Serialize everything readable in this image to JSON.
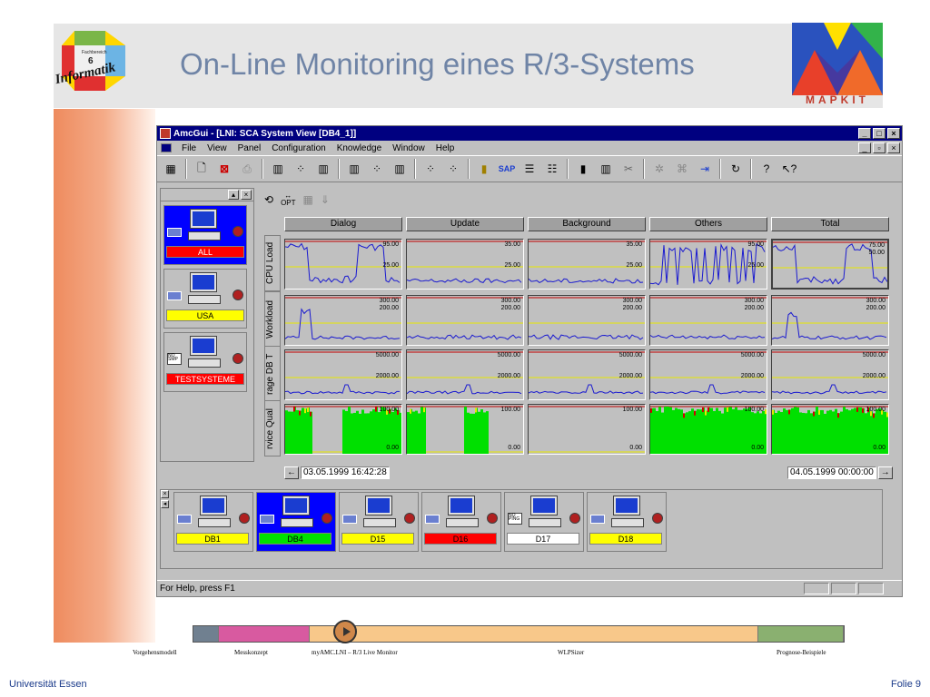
{
  "slide": {
    "title": "On-Line Monitoring eines R/3-Systems",
    "logo_left_text": [
      "Fachbereich",
      "6",
      "Informatik"
    ],
    "logo_right_text": "MAPKIT",
    "footer_left": "Universität Essen",
    "footer_right": "Folie 9"
  },
  "window": {
    "title": "AmcGui - [LNI: SCA System View [DB4_1]]",
    "menu": [
      "File",
      "View",
      "Panel",
      "Configuration",
      "Knowledge",
      "Window",
      "Help"
    ],
    "status": "For Help, press F1",
    "mini_toolbar_opt": "OPT"
  },
  "left_systems": [
    {
      "label": "ALL",
      "color": "#ff0000",
      "text_color": "#ffffff",
      "selected": true,
      "left_badge": ""
    },
    {
      "label": "USA",
      "color": "#ffff00",
      "text_color": "#000000",
      "selected": false,
      "left_badge": ""
    },
    {
      "label": "TESTSYSTEME",
      "color": "#ff0000",
      "text_color": "#ffffff",
      "selected": false,
      "left_badge": "NO SMP"
    }
  ],
  "columns": [
    "Dialog",
    "Update",
    "Background",
    "Others",
    "Total"
  ],
  "rows": [
    "CPU Load",
    "Workload",
    "rage DB T",
    "rvice Qual"
  ],
  "cell_labels": {
    "cpu": [
      [
        "95.00",
        "25.00"
      ],
      [
        "35.00",
        "25.00"
      ],
      [
        "35.00",
        "25.00"
      ],
      [
        "95.00",
        "25.00"
      ],
      [
        "75.00",
        "50.00"
      ]
    ],
    "workload": [
      [
        "300.00",
        "200.00"
      ],
      [
        "300.00",
        "200.00"
      ],
      [
        "300.00",
        "200.00"
      ],
      [
        "300.00",
        "200.00"
      ],
      [
        "300.00",
        "200.00"
      ]
    ],
    "db": [
      [
        "5000.00",
        "2000.00"
      ],
      [
        "5000.00",
        "2000.00"
      ],
      [
        "5000.00",
        "2000.00"
      ],
      [
        "5000.00",
        "2000.00"
      ],
      [
        "5000.00",
        "2000.00"
      ]
    ],
    "qual": [
      [
        "100.00",
        "0.00"
      ],
      [
        "100.00",
        "0.00"
      ],
      [
        "100.00",
        "0.00"
      ],
      [
        "100.00",
        "0.00"
      ],
      [
        "100.00",
        "0.00"
      ]
    ]
  },
  "time_start": "03.05.1999 16:42:28",
  "time_end": "04.05.1999 00:00:00",
  "bottom_systems": [
    {
      "label": "DB1",
      "color": "#ffff00",
      "selected": false,
      "left_badge": ""
    },
    {
      "label": "DB4",
      "color": "#00e000",
      "selected": true,
      "left_badge": ""
    },
    {
      "label": "D15",
      "color": "#ffff00",
      "selected": false,
      "left_badge": ""
    },
    {
      "label": "D16",
      "color": "#ff0000",
      "selected": false,
      "left_badge": ""
    },
    {
      "label": "D17",
      "color": "#ffffff",
      "selected": false,
      "left_badge": "NO PING"
    },
    {
      "label": "D18",
      "color": "#ffff00",
      "selected": false,
      "left_badge": ""
    }
  ],
  "navigation": {
    "labels": [
      "Vorgehensmodell",
      "Messkonzept",
      "myAMC.LNI – R/3 Live Monitor",
      "WLPSizer",
      "Prognose-Beispiele"
    ]
  }
}
